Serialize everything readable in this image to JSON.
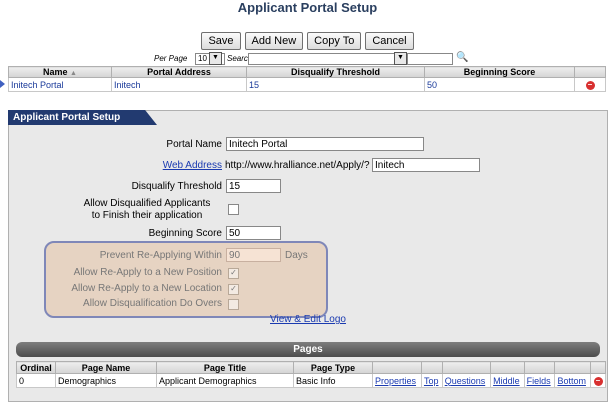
{
  "page": {
    "title": "Applicant Portal Setup"
  },
  "toolbar": {
    "save": "Save",
    "add_new": "Add New",
    "copy_to": "Copy To",
    "cancel": "Cancel"
  },
  "filter": {
    "per_page_label": "Per Page",
    "per_page_value": "10",
    "search_label": "Search"
  },
  "grid": {
    "headers": [
      "Name",
      "Portal Address",
      "Disqualify Threshold",
      "Beginning Score"
    ],
    "rows": [
      {
        "name": "Initech Portal",
        "address": "Initech",
        "threshold": "15",
        "score": "50"
      }
    ]
  },
  "panel": {
    "title": "Applicant Portal Setup"
  },
  "form": {
    "portal_name_label": "Portal Name",
    "portal_name_value": "Initech Portal",
    "web_address_label": "Web Address",
    "web_address_prefix": "http://www.hralliance.net/Apply/?",
    "web_address_value": "Initech",
    "disqualify_label": "Disqualify Threshold",
    "disqualify_value": "15",
    "allow_disq_line1": "Allow Disqualified Applicants",
    "allow_disq_line2": "to Finish their application",
    "beginning_label": "Beginning Score",
    "beginning_value": "50",
    "prevent_label": "Prevent Re-Applying Within",
    "prevent_value": "90",
    "prevent_unit": "Days",
    "reapply_position_label": "Allow Re-Apply to a New Position",
    "reapply_location_label": "Allow Re-Apply to a New Location",
    "do_overs_label": "Allow Disqualification Do Overs",
    "logo_link": "View & Edit Logo"
  },
  "pages": {
    "bar_title": "Pages",
    "headers": [
      "Ordinal",
      "Page Name",
      "Page Title",
      "Page Type"
    ],
    "rows": [
      {
        "ordinal": "0",
        "name": "Demographics",
        "title": "Applicant Demographics",
        "type": "Basic Info"
      }
    ],
    "actions": [
      "Properties",
      "Top",
      "Questions",
      "Middle",
      "Fields",
      "Bottom"
    ]
  }
}
